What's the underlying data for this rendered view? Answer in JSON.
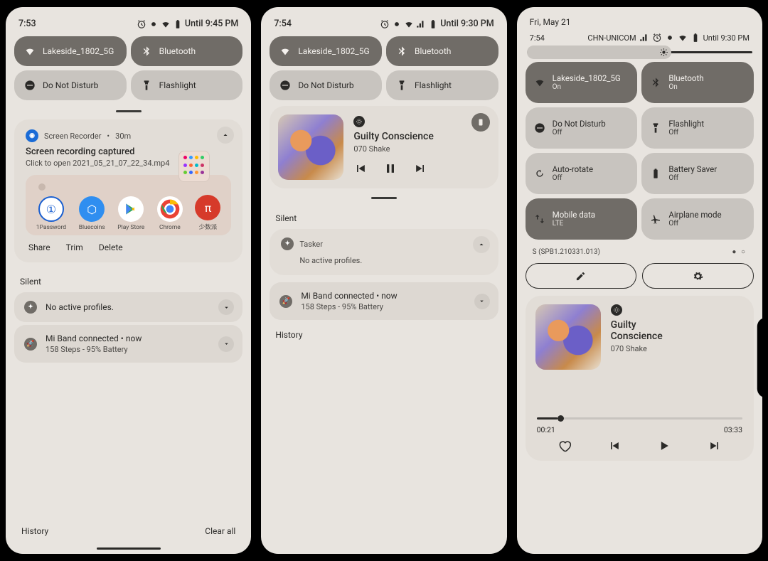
{
  "panel1": {
    "time": "7:53",
    "alarm_until": "Until 9:45 PM",
    "qs": {
      "wifi": "Lakeside_1802_5G",
      "bluetooth": "Bluetooth",
      "dnd": "Do Not Disturb",
      "flash": "Flashlight"
    },
    "notif1": {
      "app": "Screen Recorder",
      "age": "30m",
      "title": "Screen recording captured",
      "subtitle": "Click to open 2021_05_21_07_22_34.mp4",
      "share_apps": [
        "1Password",
        "Bluecoins",
        "Play Store",
        "Chrome",
        "少数派"
      ],
      "actions": [
        "Share",
        "Trim",
        "Delete"
      ]
    },
    "silent_label": "Silent",
    "row1": {
      "title": "No active profiles."
    },
    "row2": {
      "title": "Mi Band connected",
      "age": "now",
      "sub": "158 Steps - 95% Battery"
    },
    "footer": {
      "history": "History",
      "clear": "Clear all"
    }
  },
  "panel2": {
    "time": "7:54",
    "alarm_until": "Until 9:30 PM",
    "qs": {
      "wifi": "Lakeside_1802_5G",
      "bluetooth": "Bluetooth",
      "dnd": "Do Not Disturb",
      "flash": "Flashlight"
    },
    "media": {
      "title": "Guilty Conscience",
      "artist": "070 Shake"
    },
    "silent_label": "Silent",
    "tasker": {
      "app": "Tasker",
      "msg": "No active profiles."
    },
    "miband": {
      "title": "Mi Band connected",
      "age": "now",
      "sub": "158 Steps - 95% Battery"
    },
    "history": "History"
  },
  "panel3": {
    "date": "Fri, May 21",
    "time": "7:54",
    "carrier": "CHN-UNICOM",
    "alarm_until": "Until 9:30 PM",
    "tiles": [
      {
        "name": "wifi",
        "label": "Lakeside_1802_5G",
        "sub": "On",
        "on": true
      },
      {
        "name": "bluetooth",
        "label": "Bluetooth",
        "sub": "On",
        "on": true
      },
      {
        "name": "dnd",
        "label": "Do Not Disturb",
        "sub": "Off",
        "on": false
      },
      {
        "name": "flash",
        "label": "Flashlight",
        "sub": "Off",
        "on": false
      },
      {
        "name": "rotate",
        "label": "Auto-rotate",
        "sub": "Off",
        "on": false
      },
      {
        "name": "battery",
        "label": "Battery Saver",
        "sub": "Off",
        "on": false
      },
      {
        "name": "data",
        "label": "Mobile data",
        "sub": "LTE",
        "on": true
      },
      {
        "name": "airplane",
        "label": "Airplane mode",
        "sub": "Off",
        "on": false
      }
    ],
    "build": "S (SPB1.210331.013)",
    "page_dots": "● ○",
    "media": {
      "title": "Guilty Conscience",
      "artist": "070 Shake",
      "elapsed": "00:21",
      "total": "03:33"
    }
  }
}
